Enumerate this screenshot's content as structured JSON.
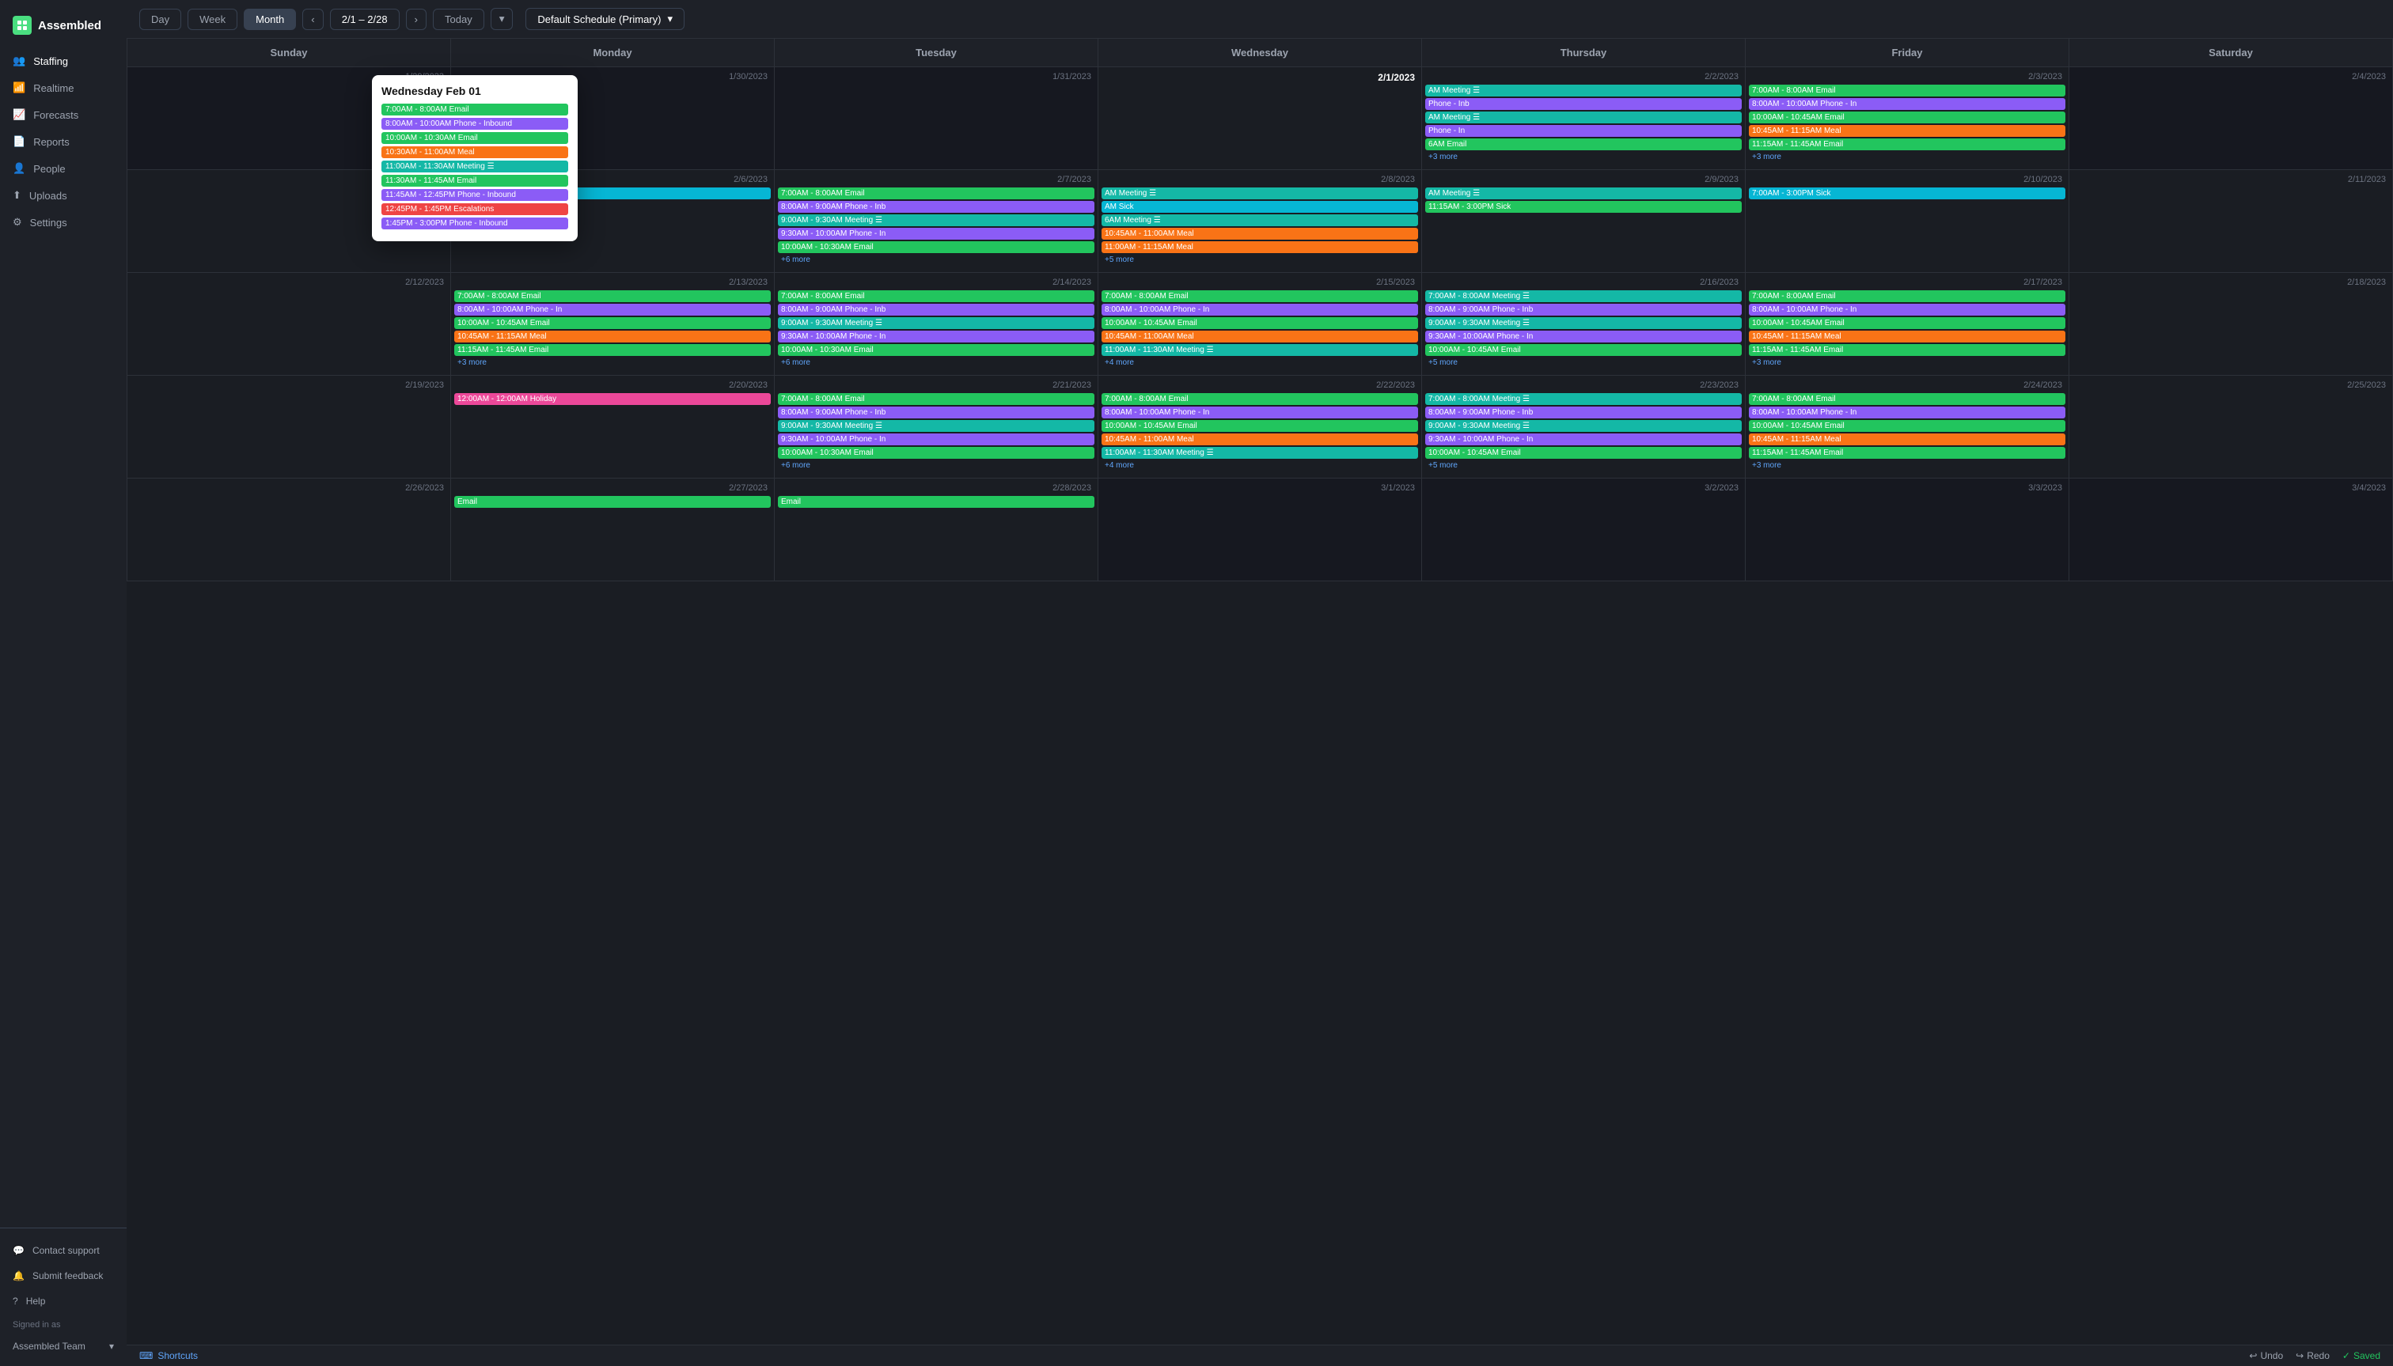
{
  "app": {
    "name": "Assembled",
    "logo_char": "A"
  },
  "sidebar": {
    "nav_items": [
      {
        "id": "staffing",
        "label": "Staffing",
        "active": true
      },
      {
        "id": "realtime",
        "label": "Realtime",
        "active": false
      },
      {
        "id": "forecasts",
        "label": "Forecasts",
        "active": false
      },
      {
        "id": "reports",
        "label": "Reports",
        "active": false
      },
      {
        "id": "people",
        "label": "People",
        "active": false
      },
      {
        "id": "uploads",
        "label": "Uploads",
        "active": false
      },
      {
        "id": "settings",
        "label": "Settings",
        "active": false
      }
    ],
    "bottom_items": [
      {
        "id": "contact-support",
        "label": "Contact support"
      },
      {
        "id": "submit-feedback",
        "label": "Submit feedback"
      },
      {
        "id": "help",
        "label": "Help"
      }
    ],
    "signed_in_as": "Signed in as",
    "user": "Assembled Team"
  },
  "topbar": {
    "view_buttons": [
      "Day",
      "Week",
      "Month"
    ],
    "active_view": "Month",
    "prev_label": "‹",
    "next_label": "›",
    "date_range": "2/1 – 2/28",
    "today_label": "Today",
    "dropdown_arrow": "▾",
    "schedule_label": "Default Schedule (Primary)"
  },
  "calendar": {
    "headers": [
      "Sunday",
      "Monday",
      "Tuesday",
      "Wednesday",
      "Thursday",
      "Friday",
      "Saturday"
    ],
    "rows": [
      {
        "cells": [
          {
            "date": "1/29/2023",
            "other": true,
            "events": []
          },
          {
            "date": "1/30/2023",
            "other": true,
            "events": []
          },
          {
            "date": "1/31/2023",
            "other": true,
            "events": []
          },
          {
            "date": "2/1/2023",
            "bold": true,
            "highlight": true,
            "events": [
              {
                "label": "7:00AM - 8:00AM Email",
                "color": "green"
              },
              {
                "label": "8:00AM - 10:00AM Phone - Inbound",
                "color": "purple"
              },
              {
                "label": "10:00AM - 10:30AM Email",
                "color": "green"
              },
              {
                "label": "10:30AM - 11:00AM Meal",
                "color": "orange"
              },
              {
                "label": "11:00AM - 11:30AM Meeting ☰",
                "color": "teal"
              },
              {
                "label": "11:30AM - 11:45AM Email",
                "color": "green"
              },
              {
                "label": "11:45AM - 12:45PM Phone - Inbound",
                "color": "purple"
              },
              {
                "label": "12:45PM - 1:45PM Escalations",
                "color": "coral"
              },
              {
                "label": "1:45PM - 3:00PM Phone - Inbound",
                "color": "purple"
              }
            ]
          },
          {
            "date": "2/2/2023",
            "events": [
              {
                "label": "AM Meeting ☰",
                "color": "teal"
              },
              {
                "label": "Phone - Inb",
                "color": "purple"
              },
              {
                "label": "AM Meeting ☰",
                "color": "teal"
              },
              {
                "label": "Phone - In",
                "color": "purple"
              },
              {
                "label": "6AM Email",
                "color": "green"
              }
            ],
            "more": "+3 more"
          },
          {
            "date": "2/3/2023",
            "events": [
              {
                "label": "7:00AM - 8:00AM Email",
                "color": "green"
              },
              {
                "label": "8:00AM - 10:00AM Phone - In",
                "color": "purple"
              },
              {
                "label": "10:00AM - 10:45AM Email",
                "color": "green"
              },
              {
                "label": "10:45AM - 11:15AM Meal",
                "color": "orange"
              },
              {
                "label": "11:15AM - 11:45AM Email",
                "color": "green"
              }
            ],
            "more": "+3 more"
          },
          {
            "date": "2/4/2023",
            "events": []
          }
        ]
      },
      {
        "cells": [
          {
            "date": "2/5/2023",
            "events": []
          },
          {
            "date": "2/6/2023",
            "events": [
              {
                "label": "7:00AM - 3:00PM Sick",
                "color": "cyan"
              }
            ]
          },
          {
            "date": "2/7/2023",
            "events": [
              {
                "label": "7:00AM - 8:00AM Email",
                "color": "green"
              },
              {
                "label": "8:00AM - 9:00AM Phone - Inb",
                "color": "purple"
              },
              {
                "label": "9:00AM - 9:30AM Meeting ☰",
                "color": "teal"
              },
              {
                "label": "9:30AM - 10:00AM Phone - In",
                "color": "purple"
              },
              {
                "label": "10:00AM - 10:30AM Email",
                "color": "green"
              }
            ],
            "more": "+6 more"
          },
          {
            "date": "2/8/2023",
            "events": [
              {
                "label": "AM Meeting ☰",
                "color": "teal"
              },
              {
                "label": "AM Sick",
                "color": "cyan"
              },
              {
                "label": "6AM Meeting ☰",
                "color": "teal"
              },
              {
                "label": "10:45AM - 11:00AM Meal",
                "color": "orange"
              },
              {
                "label": "11:00AM - 11:15AM Meal",
                "color": "orange"
              }
            ],
            "more": "+5 more"
          },
          {
            "date": "2/9/2023",
            "events": [
              {
                "label": "AM Meeting ☰",
                "color": "teal"
              }
            ]
          },
          {
            "date": "2/10/2023",
            "events": [
              {
                "label": "7:00AM - 3:00PM Sick",
                "color": "cyan"
              }
            ]
          },
          {
            "date": "2/11/2023",
            "events": []
          }
        ]
      },
      {
        "cells": [
          {
            "date": "2/12/2023",
            "events": []
          },
          {
            "date": "2/13/2023",
            "events": [
              {
                "label": "7:00AM - 8:00AM Email",
                "color": "green"
              },
              {
                "label": "8:00AM - 10:00AM Phone - In",
                "color": "purple"
              },
              {
                "label": "10:00AM - 10:45AM Email",
                "color": "green"
              },
              {
                "label": "10:45AM - 11:15AM Meal",
                "color": "orange"
              },
              {
                "label": "11:15AM - 11:45AM Email",
                "color": "green"
              }
            ],
            "more": "+3 more"
          },
          {
            "date": "2/14/2023",
            "events": [
              {
                "label": "7:00AM - 8:00AM Email",
                "color": "green"
              },
              {
                "label": "8:00AM - 9:00AM Phone - Inb",
                "color": "purple"
              },
              {
                "label": "9:00AM - 9:30AM Meeting ☰",
                "color": "teal"
              },
              {
                "label": "9:30AM - 10:00AM Phone - In",
                "color": "purple"
              },
              {
                "label": "10:00AM - 10:30AM Email",
                "color": "green"
              }
            ],
            "more": "+6 more"
          },
          {
            "date": "2/15/2023",
            "events": [
              {
                "label": "7:00AM - 8:00AM Email",
                "color": "green"
              },
              {
                "label": "8:00AM - 10:00AM Phone - In",
                "color": "purple"
              },
              {
                "label": "10:00AM - 10:45AM Email",
                "color": "green"
              },
              {
                "label": "10:45AM - 11:00AM Meal",
                "color": "orange"
              },
              {
                "label": "11:00AM - 11:30AM Meeting ☰",
                "color": "teal"
              }
            ],
            "more": "+4 more"
          },
          {
            "date": "2/16/2023",
            "events": [
              {
                "label": "7:00AM - 8:00AM Meeting ☰",
                "color": "teal"
              },
              {
                "label": "8:00AM - 9:00AM Phone - Inb",
                "color": "purple"
              },
              {
                "label": "9:00AM - 9:30AM Meeting ☰",
                "color": "teal"
              },
              {
                "label": "9:30AM - 10:00AM Phone - In",
                "color": "purple"
              },
              {
                "label": "10:00AM - 10:45AM Email",
                "color": "green"
              }
            ],
            "more": "+5 more"
          },
          {
            "date": "2/17/2023",
            "events": [
              {
                "label": "7:00AM - 8:00AM Email",
                "color": "green"
              },
              {
                "label": "8:00AM - 10:00AM Phone - In",
                "color": "purple"
              },
              {
                "label": "10:00AM - 10:45AM Email",
                "color": "green"
              },
              {
                "label": "10:45AM - 11:15AM Meal",
                "color": "orange"
              },
              {
                "label": "11:15AM - 11:45AM Email",
                "color": "green"
              }
            ],
            "more": "+3 more"
          },
          {
            "date": "2/18/2023",
            "events": []
          }
        ]
      },
      {
        "cells": [
          {
            "date": "2/19/2023",
            "events": []
          },
          {
            "date": "2/20/2023",
            "events": [
              {
                "label": "12:00AM - 12:00AM Holiday",
                "color": "pink"
              }
            ]
          },
          {
            "date": "2/21/2023",
            "events": [
              {
                "label": "7:00AM - 8:00AM Email",
                "color": "green"
              },
              {
                "label": "8:00AM - 9:00AM Phone - Inb",
                "color": "purple"
              },
              {
                "label": "9:00AM - 9:30AM Meeting ☰",
                "color": "teal"
              },
              {
                "label": "9:30AM - 10:00AM Phone - In",
                "color": "purple"
              },
              {
                "label": "10:00AM - 10:30AM Email",
                "color": "green"
              }
            ],
            "more": "+6 more"
          },
          {
            "date": "2/22/2023",
            "events": [
              {
                "label": "7:00AM - 8:00AM Email",
                "color": "green"
              },
              {
                "label": "8:00AM - 10:00AM Phone - In",
                "color": "purple"
              },
              {
                "label": "10:00AM - 10:45AM Email",
                "color": "green"
              },
              {
                "label": "10:45AM - 11:00AM Meal",
                "color": "orange"
              },
              {
                "label": "11:00AM - 11:30AM Meeting ☰",
                "color": "teal"
              }
            ],
            "more": "+4 more"
          },
          {
            "date": "2/23/2023",
            "events": [
              {
                "label": "7:00AM - 8:00AM Meeting ☰",
                "color": "teal"
              },
              {
                "label": "8:00AM - 9:00AM Phone - Inb",
                "color": "purple"
              },
              {
                "label": "9:00AM - 9:30AM Meeting ☰",
                "color": "teal"
              },
              {
                "label": "9:30AM - 10:00AM Phone - In",
                "color": "purple"
              },
              {
                "label": "10:00AM - 10:45AM Email",
                "color": "green"
              }
            ],
            "more": "+5 more"
          },
          {
            "date": "2/24/2023",
            "events": [
              {
                "label": "7:00AM - 8:00AM Email",
                "color": "green"
              },
              {
                "label": "8:00AM - 10:00AM Phone - In",
                "color": "purple"
              },
              {
                "label": "10:00AM - 10:45AM Email",
                "color": "green"
              },
              {
                "label": "10:45AM - 11:15AM Meal",
                "color": "orange"
              },
              {
                "label": "11:15AM - 11:45AM Email",
                "color": "green"
              }
            ],
            "more": "+3 more"
          },
          {
            "date": "2/25/2023",
            "events": []
          }
        ]
      },
      {
        "cells": [
          {
            "date": "2/26/2023",
            "events": []
          },
          {
            "date": "2/27/2023",
            "events": [
              {
                "label": "Email",
                "color": "green"
              }
            ]
          },
          {
            "date": "2/28/2023",
            "events": [
              {
                "label": "Email",
                "color": "green"
              }
            ]
          },
          {
            "date": "3/1/2023",
            "other": true,
            "events": []
          },
          {
            "date": "3/2/2023",
            "other": true,
            "events": []
          },
          {
            "date": "3/3/2023",
            "other": true,
            "events": []
          },
          {
            "date": "3/4/2023",
            "other": true,
            "events": []
          }
        ]
      }
    ]
  },
  "popup": {
    "title": "Wednesday Feb 01",
    "events": [
      {
        "label": "7:00AM - 8:00AM Email",
        "color": "green"
      },
      {
        "label": "8:00AM - 10:00AM Phone - Inbound",
        "color": "purple"
      },
      {
        "label": "10:00AM - 10:30AM Email",
        "color": "green"
      },
      {
        "label": "10:30AM - 11:00AM Meal",
        "color": "orange"
      },
      {
        "label": "11:00AM - 11:30AM Meeting ☰",
        "color": "teal"
      },
      {
        "label": "11:30AM - 11:45AM Email",
        "color": "green"
      },
      {
        "label": "11:45AM - 12:45PM Phone - Inbound",
        "color": "purple"
      },
      {
        "label": "12:45PM - 1:45PM Escalations",
        "color": "coral"
      },
      {
        "label": "1:45PM - 3:00PM Phone - Inbound",
        "color": "purple"
      }
    ]
  },
  "bottombar": {
    "shortcuts_label": "Shortcuts",
    "undo_label": "Undo",
    "redo_label": "Redo",
    "saved_label": "Saved"
  },
  "colors": {
    "green": "#22c55e",
    "purple": "#8b5cf6",
    "orange": "#f97316",
    "teal": "#14b8a6",
    "coral": "#ef4444",
    "cyan": "#06b6d4",
    "pink": "#ec4899"
  }
}
